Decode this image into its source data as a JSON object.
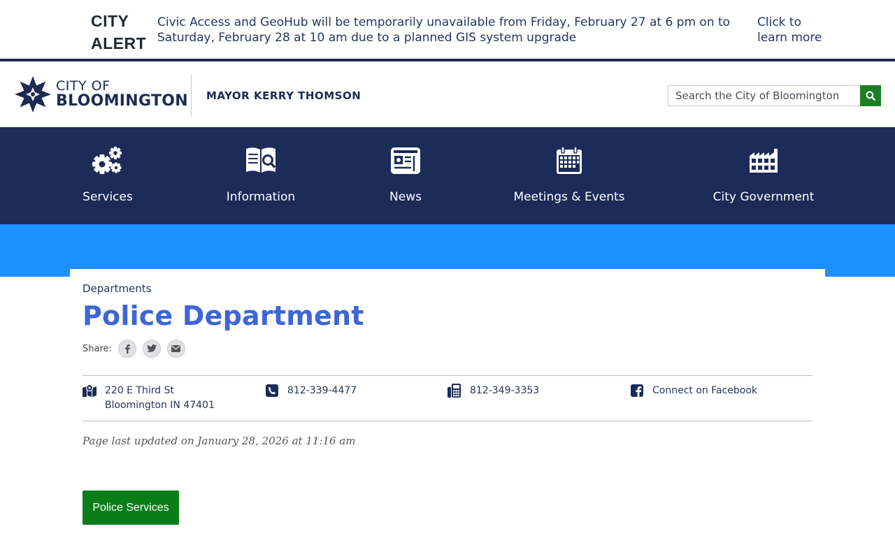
{
  "alert": {
    "title_line1": "CITY",
    "title_line2": "ALERT",
    "message": "Civic Access and GeoHub will be temporarily unavailable from Friday, February 27 at 6 pm on to Saturday, February 28 at 10 am due to a planned GIS system upgrade",
    "link": "Click to learn more"
  },
  "header": {
    "logo_line1": "CITY OF",
    "logo_line2": "BLOOMINGTON",
    "mayor": "MAYOR KERRY THOMSON",
    "search_placeholder": "Search the City of Bloomington"
  },
  "nav": {
    "items": [
      {
        "label": "Services",
        "icon": "gears-icon"
      },
      {
        "label": "Information",
        "icon": "book-search-icon"
      },
      {
        "label": "News",
        "icon": "newspaper-icon"
      },
      {
        "label": "Meetings & Events",
        "icon": "calendar-icon"
      },
      {
        "label": "City Government",
        "icon": "building-icon"
      }
    ]
  },
  "page": {
    "breadcrumb": "Departments",
    "title": "Police Department",
    "share_label": "Share:",
    "share_icons": [
      "facebook-icon",
      "twitter-icon",
      "email-icon"
    ],
    "contact": {
      "address_line1": "220 E Third St",
      "address_line2": "Bloomington IN 47401",
      "phone": "812-339-4477",
      "fax": "812-349-3353",
      "facebook": "Connect on Facebook"
    },
    "updated": "Page last updated on January 28, 2026 at 11:16 am",
    "services_button": "Police Services"
  },
  "colors": {
    "navy": "#1c2b57",
    "band_blue": "#1e90ff",
    "title_blue": "#3d66d6",
    "green": "#0b7d18"
  }
}
